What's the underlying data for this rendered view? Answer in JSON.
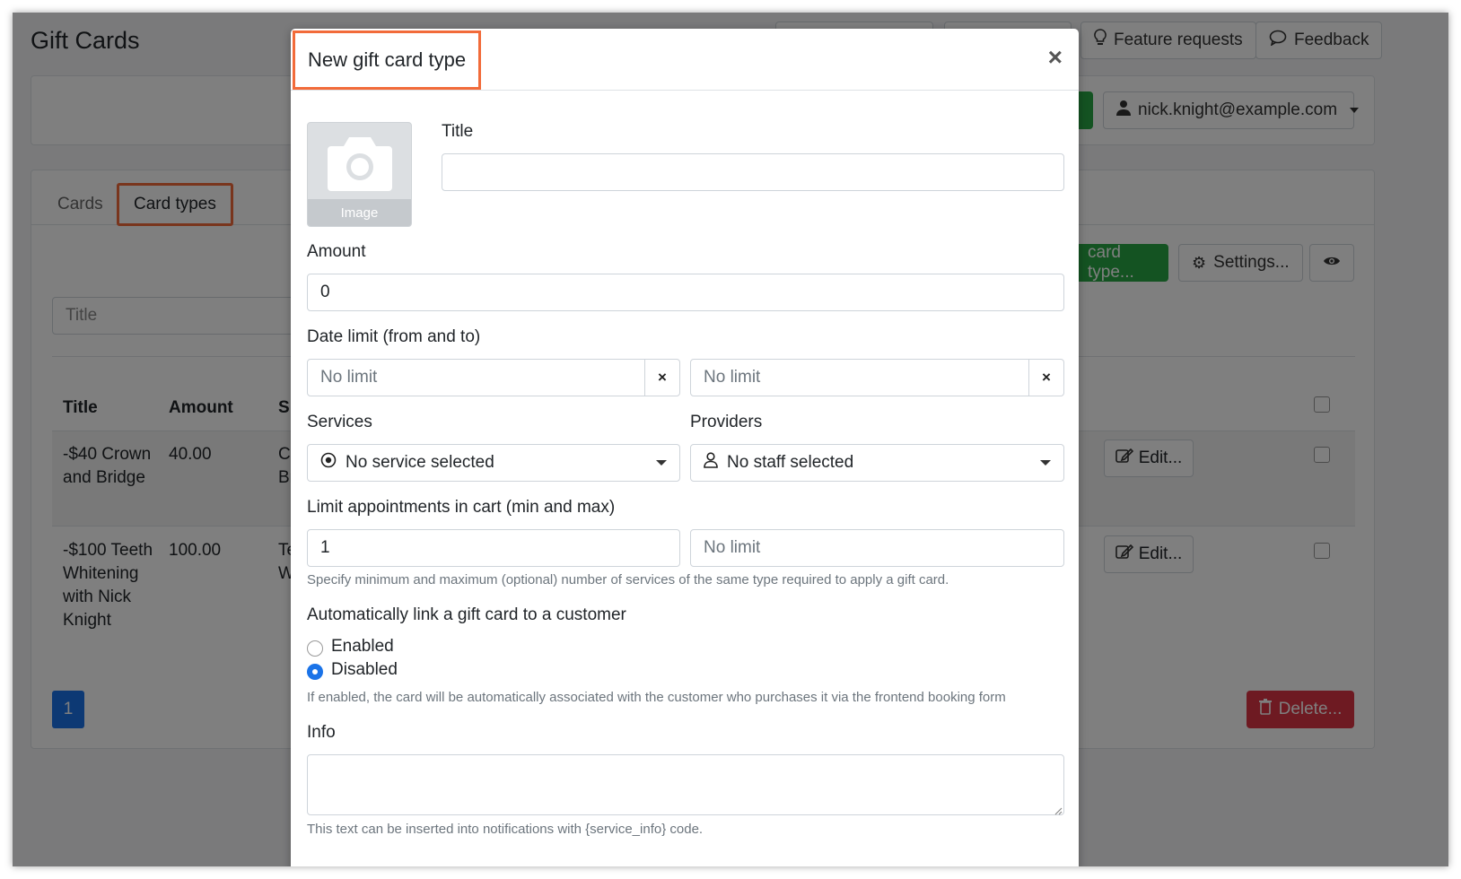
{
  "page": {
    "title": "Gift Cards",
    "top_buttons": {
      "feature_requests": "Feature requests",
      "feedback": "Feedback"
    },
    "user_menu": "nick.knight@example.com",
    "tabs": [
      {
        "label": "Cards"
      },
      {
        "label": "Card types"
      }
    ],
    "filter_placeholder": "Title",
    "new_card_type_button": "card type...",
    "settings_button": "Settings...",
    "table": {
      "headers": {
        "title": "Title",
        "amount": "Amount",
        "services": "S"
      },
      "rows": [
        {
          "title": "-$40 Crown and Bridge",
          "amount": "40.00",
          "services": "C Br",
          "edit": "Edit..."
        },
        {
          "title": "-$100 Teeth Whitening with Nick Knight",
          "amount": "100.00",
          "services": "Te W",
          "edit": "Edit..."
        }
      ]
    },
    "pagination": {
      "current": "1"
    },
    "delete_button": "Delete..."
  },
  "modal": {
    "title": "New gift card type",
    "close": "×",
    "image_label": "Image",
    "title_label": "Title",
    "title_value": "",
    "amount_label": "Amount",
    "amount_value": "0",
    "date_limit_label": "Date limit (from and to)",
    "date_from_placeholder": "No limit",
    "date_to_placeholder": "No limit",
    "clear_symbol": "×",
    "services_label": "Services",
    "services_value": "No service selected",
    "providers_label": "Providers",
    "providers_value": "No staff selected",
    "limit_label": "Limit appointments in cart (min and max)",
    "limit_min_value": "1",
    "limit_max_placeholder": "No limit",
    "limit_help": "Specify minimum and maximum (optional) number of services of the same type required to apply a gift card.",
    "auto_link_label": "Automatically link a gift card to a customer",
    "radio_enabled": "Enabled",
    "radio_disabled": "Disabled",
    "auto_link_selected": "Disabled",
    "auto_link_help": "If enabled, the card will be automatically associated with the customer who purchases it via the frontend booking form",
    "info_label": "Info",
    "info_value": "",
    "info_help": "This text can be inserted into notifications with {service_info} code."
  },
  "colors": {
    "highlight": "#f26b3a",
    "primary": "#1a73e8",
    "success": "#28a745",
    "danger": "#dc3545"
  }
}
